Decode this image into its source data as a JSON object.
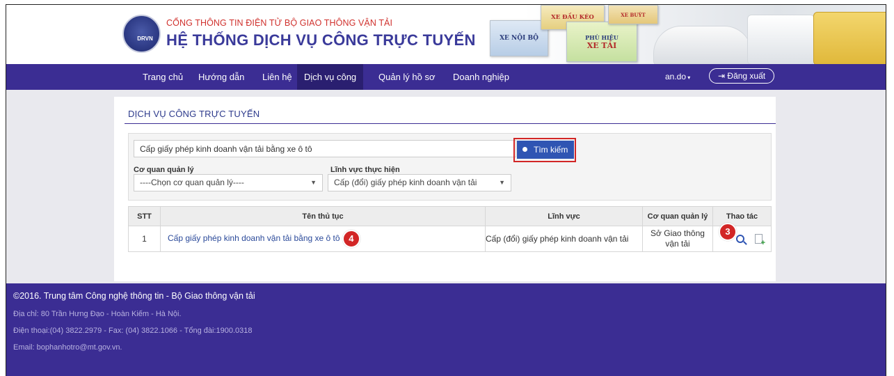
{
  "header": {
    "logo_text": "DRVN",
    "top_title": "CỔNG THÔNG TIN ĐIỆN TỬ BỘ GIAO THÔNG VẬN TẢI",
    "main_title": "HỆ THỐNG DỊCH VỤ CÔNG TRỰC TUYẾN",
    "banner_cards": [
      "XE NỘI BỘ",
      "XE ĐẦU KÉO",
      "PHÙ HIỆU",
      "XE TẢI",
      "XE BUÝT"
    ]
  },
  "nav": {
    "items": [
      "Trang chủ",
      "Hướng dẫn",
      "Liên hệ",
      "Dịch vụ công",
      "Quản lý hồ sơ",
      "Doanh nghiệp"
    ],
    "active": "Dịch vụ công",
    "user": "an.do",
    "logout_label": "Đăng xuất"
  },
  "page": {
    "section_title": "DỊCH VỤ CÔNG TRỰC TUYẾN"
  },
  "search": {
    "query": "Cấp giấy phép kinh doanh vận tải bằng xe ô tô",
    "button_label": "Tìm kiếm",
    "agency_label": "Cơ quan quản lý",
    "agency_value": "----Chọn cơ quan quản lý----",
    "field_label": "Lĩnh vực thực hiện",
    "field_value": "Cấp (đổi) giấy phép kinh doanh vận tải"
  },
  "table": {
    "headers": [
      "STT",
      "Tên thủ tục",
      "Lĩnh vực",
      "Cơ quan quản lý",
      "Thao tác"
    ],
    "rows": [
      {
        "stt": "1",
        "name": "Cấp giấy phép kinh doanh vận tải bằng xe ô tô",
        "field": "Cấp (đổi) giấy phép kinh doanh vận tải",
        "agency": "Sở Giao thông vận tải"
      }
    ]
  },
  "annotations": {
    "badge_name": "4",
    "badge_action": "3"
  },
  "footer": {
    "copyright": "©2016. Trung tâm Công nghệ thông tin - Bộ Giao thông vận tải",
    "address": "Địa chỉ: 80 Trần Hưng Đạo - Hoàn Kiếm - Hà Nội.",
    "phone": "Điện thoại:(04) 3822.2979 - Fax: (04) 3822.1066 - Tổng đài:1900.0318",
    "email": "Email: bophanhotro@mt.gov.vn."
  },
  "colors": {
    "nav": "#3b2d93",
    "accent": "#2f55b3",
    "highlight": "#d22626"
  }
}
